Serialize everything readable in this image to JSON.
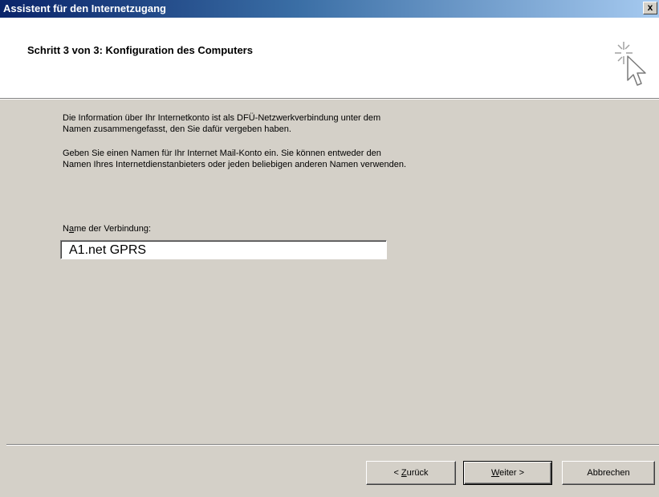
{
  "window": {
    "title": "Assistent für den Internetzugang",
    "close_label": "x"
  },
  "header": {
    "step_title": "Schritt  3 von 3: Konfiguration des Computers",
    "icon": "wizard-cursor-icon"
  },
  "body": {
    "paragraph1_line1": "Die Information über Ihr Internetkonto ist als DFÜ-Netzwerkverbindung unter dem",
    "paragraph1_line2": "Namen zusammengefasst, den Sie dafür vergeben haben.",
    "paragraph2_line1": "Geben Sie einen Namen für Ihr Internet Mail-Konto ein. Sie können entweder den",
    "paragraph2_line2": "Namen Ihres Internetdienstanbieters oder jeden beliebigen anderen Namen verwenden."
  },
  "connection_name": {
    "label_prefix": "N",
    "label_accel": "a",
    "label_suffix": "me der Verbindung:",
    "value": "A1.net GPRS"
  },
  "buttons": {
    "back_prefix": "< ",
    "back_accel": "Z",
    "back_suffix": "urück",
    "next_accel": "W",
    "next_suffix": "eiter >",
    "cancel_label": "Abbrechen"
  }
}
